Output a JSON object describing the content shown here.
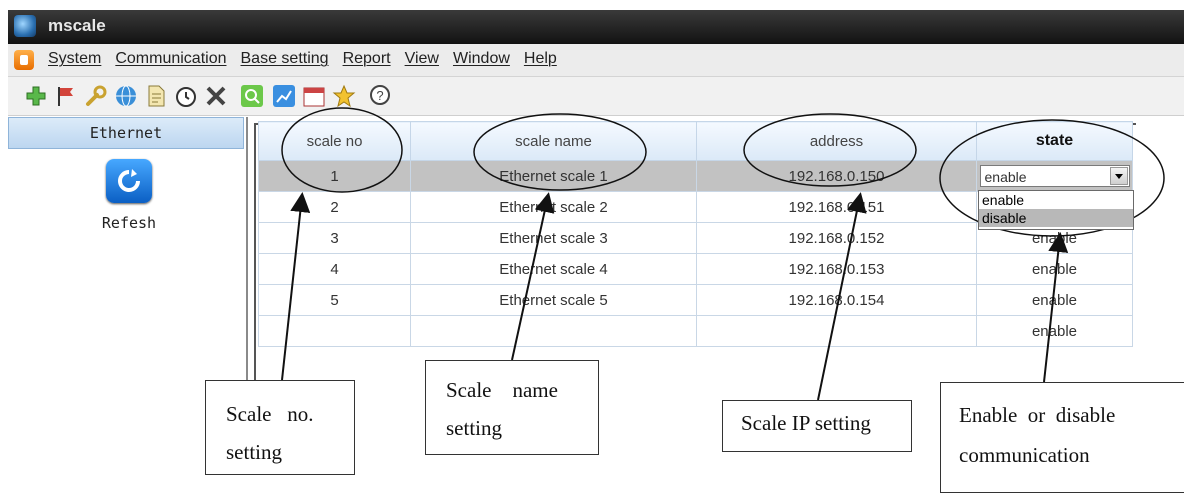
{
  "window": {
    "title": "mscale"
  },
  "menu": [
    "System",
    "Communication",
    "Base setting",
    "Report",
    "View",
    "Window",
    "Help"
  ],
  "toolbar": {
    "icons": [
      "add-icon",
      "flag-icon",
      "wrench-icon",
      "globe-icon",
      "document-icon",
      "clock-icon",
      "tools-icon",
      "search-icon",
      "chart-icon",
      "calendar-icon",
      "star-icon",
      "help-icon"
    ]
  },
  "sidebar": {
    "header": "Ethernet",
    "refresh_label": "Refesh"
  },
  "table": {
    "columns": [
      "scale no",
      "scale name",
      "address",
      "state"
    ],
    "rows": [
      {
        "no": "1",
        "name": "Ethernet scale 1",
        "address": "192.168.0.150",
        "state": "enable"
      },
      {
        "no": "2",
        "name": "Ethernet scale 2",
        "address": "192.168.0.151",
        "state": ""
      },
      {
        "no": "3",
        "name": "Ethernet scale 3",
        "address": "192.168.0.152",
        "state": "enable"
      },
      {
        "no": "4",
        "name": "Ethernet scale 4",
        "address": "192.168.0.153",
        "state": "enable"
      },
      {
        "no": "5",
        "name": "Ethernet scale 5",
        "address": "192.168.0.154",
        "state": "enable"
      },
      {
        "no": "",
        "name": "",
        "address": "",
        "state": "enable"
      }
    ],
    "dropdown_options": [
      "enable",
      "disable"
    ],
    "dropdown_highlighted": "disable"
  },
  "annotations": {
    "scale_no": [
      "Scale   no.",
      "setting"
    ],
    "scale_name": [
      "Scale    name",
      "setting"
    ],
    "scale_ip": "Scale IP setting",
    "enable": [
      "Enable  or  disable",
      "communication"
    ]
  }
}
